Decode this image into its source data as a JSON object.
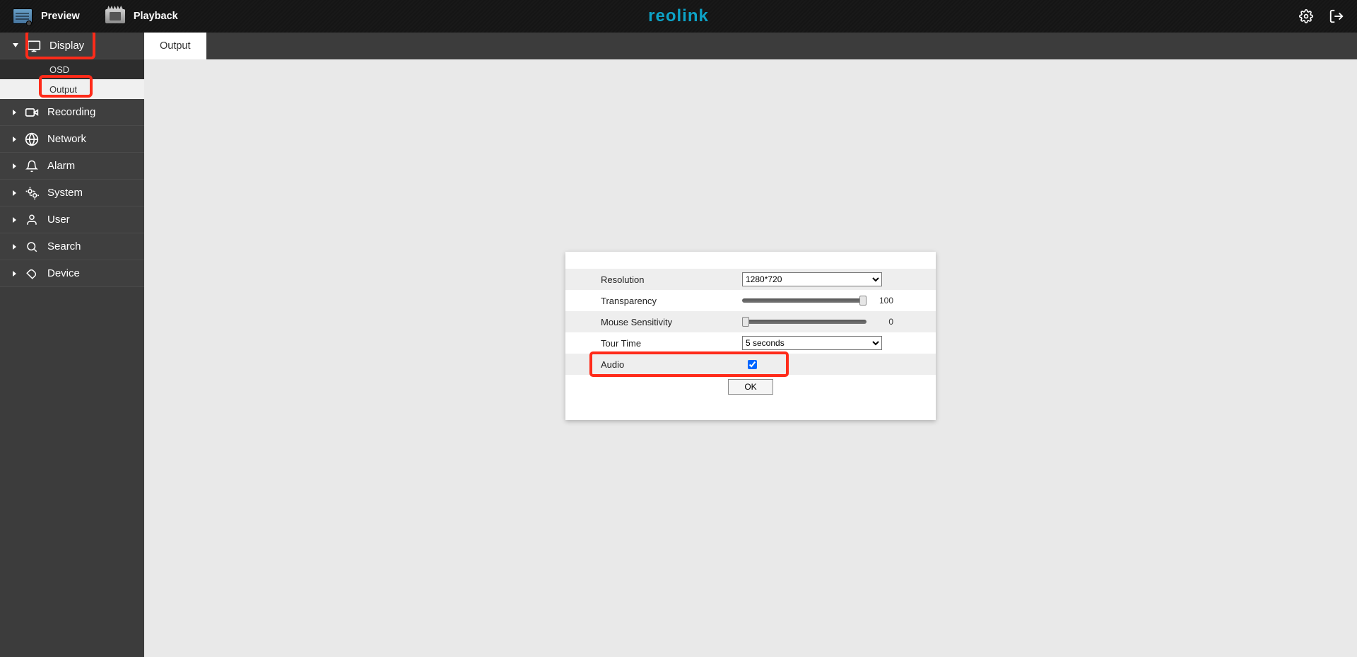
{
  "topbar": {
    "preview_label": "Preview",
    "playback_label": "Playback",
    "brand": "reolink"
  },
  "sidebar": {
    "display": {
      "label": "Display",
      "sub_osd": "OSD",
      "sub_output": "Output"
    },
    "recording": {
      "label": "Recording"
    },
    "network": {
      "label": "Network"
    },
    "alarm": {
      "label": "Alarm"
    },
    "system": {
      "label": "System"
    },
    "user": {
      "label": "User"
    },
    "search": {
      "label": "Search"
    },
    "device": {
      "label": "Device"
    }
  },
  "tab": {
    "output": "Output"
  },
  "panel": {
    "resolution_label": "Resolution",
    "resolution_value": "1280*720",
    "transparency_label": "Transparency",
    "transparency_value": "100",
    "mouse_label": "Mouse Sensitivity",
    "mouse_value": "0",
    "tour_label": "Tour Time",
    "tour_value": "5 seconds",
    "audio_label": "Audio",
    "audio_checked": true,
    "ok_label": "OK"
  }
}
